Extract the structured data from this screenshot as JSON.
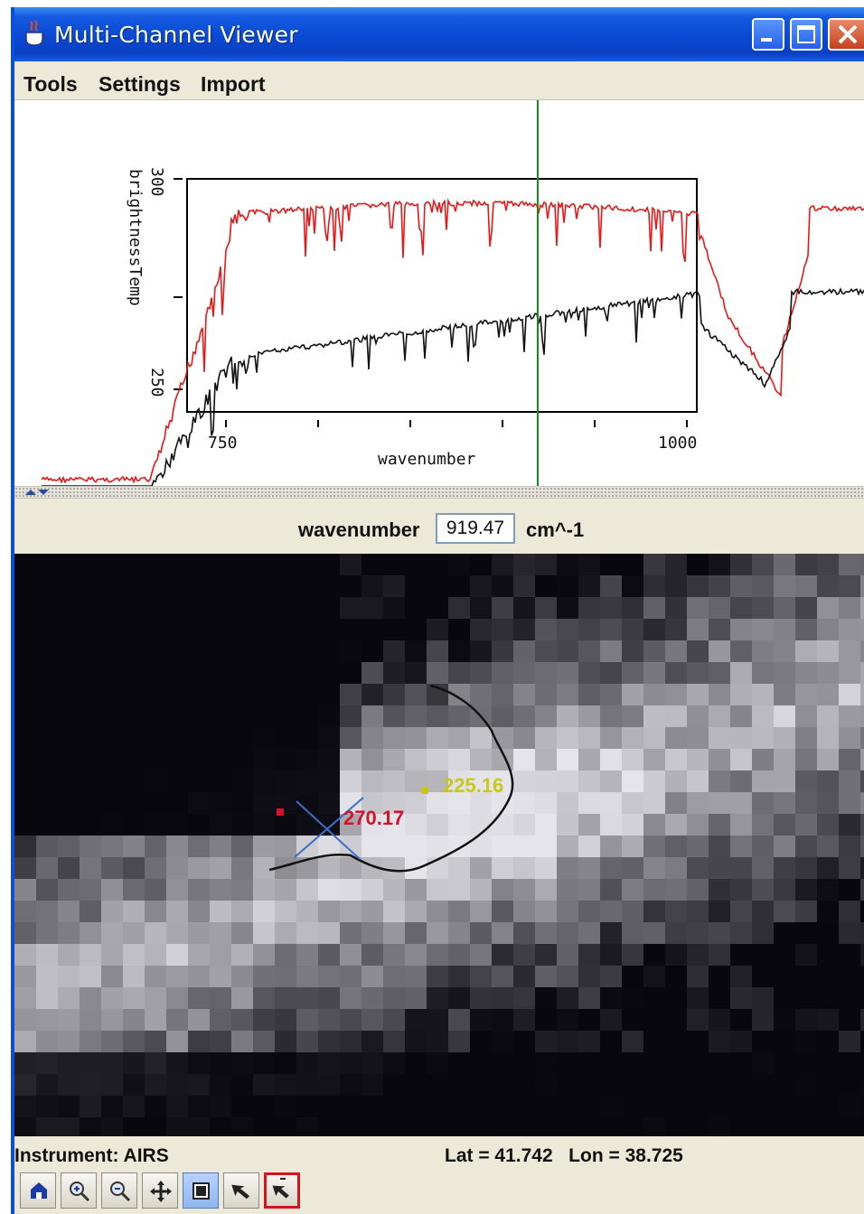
{
  "window": {
    "title": "Multi-Channel Viewer"
  },
  "menu": {
    "items": [
      "Tools",
      "Settings",
      "Import"
    ]
  },
  "spectrum_plot": {
    "ylabel": "brightnessTemp",
    "xlabel": "wavenumber",
    "ytick_labels": [
      "300",
      "250"
    ],
    "xtick_labels": [
      "750",
      "1000"
    ],
    "colors": {
      "upper_series": "#e81818",
      "lower_series": "#111111",
      "cursor": "#1a8a1a",
      "frame": "#000000"
    }
  },
  "wavenumber": {
    "label": "wavenumber",
    "value": "919.47",
    "unit": "cm^-1"
  },
  "map": {
    "probe_red_value": "270.17",
    "probe_yellow_value": "225.16",
    "colors": {
      "probe_red": "#d0142a",
      "probe_yellow": "#c8c818",
      "crosshair": "#3a6ec8",
      "coastline": "#111111"
    }
  },
  "status": {
    "instrument": "Instrument: AIRS",
    "latlon": "Lat = 41.742   Lon = 38.725"
  },
  "toolbar": {
    "tools": [
      {
        "name": "home-tool",
        "icon": "home-icon"
      },
      {
        "name": "zoom-in-tool",
        "icon": "zoom-in-icon"
      },
      {
        "name": "zoom-out-tool",
        "icon": "zoom-out-icon"
      },
      {
        "name": "pan-tool",
        "icon": "move-icon"
      },
      {
        "name": "reset-tool",
        "icon": "square-icon"
      },
      {
        "name": "select-tool",
        "icon": "arrow-icon"
      },
      {
        "name": "probe-tool",
        "icon": "probe-arrow-icon"
      }
    ]
  }
}
